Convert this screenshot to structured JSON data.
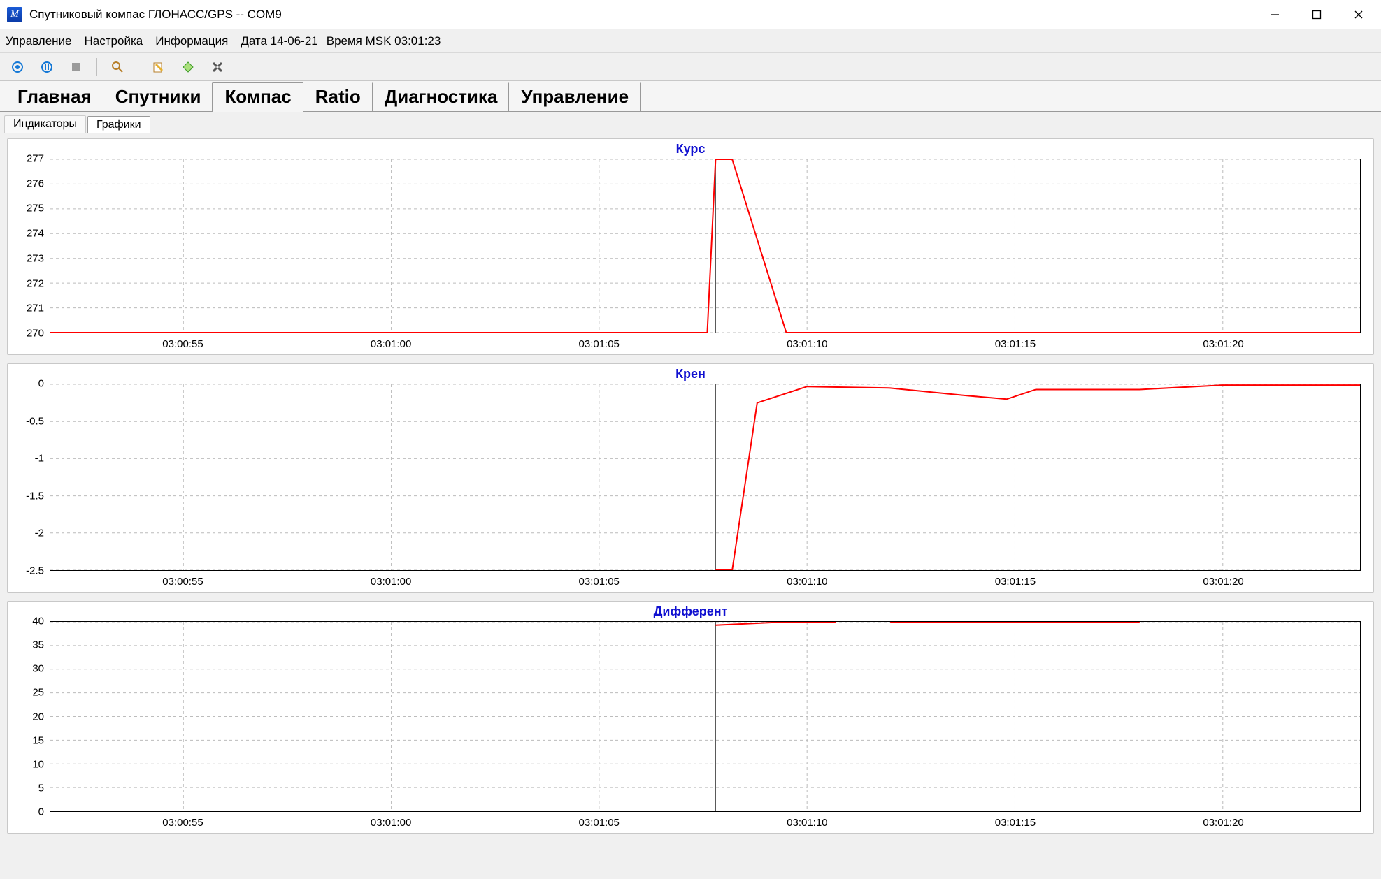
{
  "window": {
    "title": "Спутниковый компас ГЛОНАСС/GPS -- COM9"
  },
  "menu": {
    "items": [
      "Управление",
      "Настройка",
      "Информация"
    ],
    "date_label": "Дата 14-06-21",
    "time_label": "Время MSK 03:01:23"
  },
  "main_tabs": [
    "Главная",
    "Спутники",
    "Компас",
    "Ratio",
    "Диагностика",
    "Управление"
  ],
  "main_tab_active": 2,
  "sub_tabs": [
    "Индикаторы",
    "Графики"
  ],
  "sub_tab_active": 1,
  "x_ticks": [
    "03:00:55",
    "03:01:00",
    "03:01:05",
    "03:01:10",
    "03:01:15",
    "03:01:20"
  ],
  "x_range_sec": [
    51.8,
    83.3
  ],
  "chart_data": [
    {
      "title": "Курс",
      "type": "line",
      "ylim": [
        270,
        277
      ],
      "y_ticks": [
        270,
        271,
        272,
        273,
        274,
        275,
        276,
        277
      ],
      "series": [
        {
          "name": "Курс",
          "x": [
            51.8,
            67.6,
            67.8,
            68.2,
            69.5,
            71.0,
            83.3
          ],
          "y": [
            270,
            270,
            277,
            277,
            270,
            270,
            270
          ]
        }
      ]
    },
    {
      "title": "Крен",
      "type": "line",
      "ylim": [
        -2.5,
        0
      ],
      "y_ticks": [
        -2.5,
        -2,
        -1.5,
        -1,
        -0.5,
        0
      ],
      "series": [
        {
          "name": "Крен",
          "x": [
            67.8,
            68.2,
            68.8,
            70.0,
            72.0,
            73.8,
            74.8,
            75.5,
            78.0,
            80.0,
            83.3
          ],
          "y": [
            -2.5,
            -2.5,
            -0.25,
            -0.03,
            -0.05,
            -0.15,
            -0.2,
            -0.07,
            -0.07,
            -0.01,
            -0.01
          ]
        }
      ]
    },
    {
      "title": "Дифферент",
      "type": "line",
      "ylim": [
        0,
        40
      ],
      "y_ticks": [
        0,
        5,
        10,
        15,
        20,
        25,
        30,
        35,
        40
      ],
      "series": [
        {
          "name": "Дифферент",
          "segments": [
            {
              "x": [
                67.8,
                68.3,
                69.5,
                70.7
              ],
              "y": [
                39.3,
                39.5,
                40.0,
                40.0
              ]
            },
            {
              "x": [
                72.0,
                77.2,
                78.0
              ],
              "y": [
                40.0,
                40.0,
                39.9
              ]
            }
          ]
        }
      ]
    }
  ]
}
